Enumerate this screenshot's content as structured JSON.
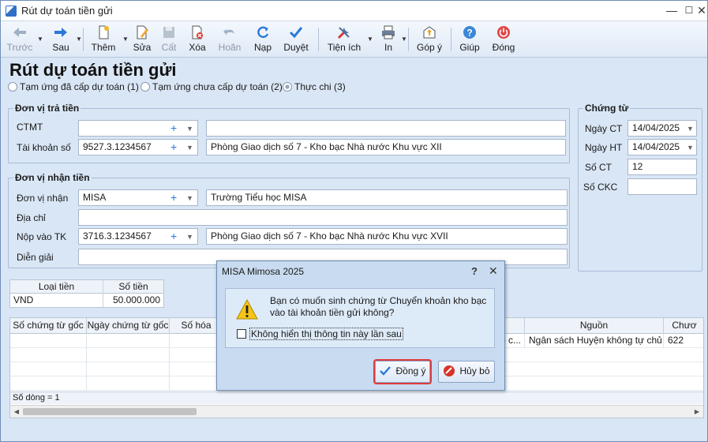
{
  "window": {
    "title": "Rút dự toán tiền gửi",
    "min": "—",
    "max": "☐",
    "close": "✕"
  },
  "toolbar": {
    "back": "Trước",
    "next": "Sau",
    "add": "Thêm",
    "edit": "Sửa",
    "save": "Cất",
    "delete": "Xóa",
    "undo": "Hoãn",
    "reload": "Nạp",
    "approve": "Duyệt",
    "utilities": "Tiện ích",
    "print": "In",
    "feedback": "Góp ý",
    "help": "Giúp",
    "close": "Đóng"
  },
  "page": {
    "title": "Rút dự toán tiền gửi",
    "radios": [
      "Tạm ứng đã cấp dự toán (1)",
      "Tạm ứng chưa cấp dự toán (2)",
      "Thực chi (3)"
    ]
  },
  "payer": {
    "legend": "Đơn vị trả tiền",
    "ctmt_label": "CTMT",
    "ctmt_value": "",
    "ctmt_desc": "",
    "account_label": "Tài khoản số",
    "account_value": "9527.3.1234567",
    "account_desc": "Phòng Giao dịch số 7 - Kho bạc Nhà nước Khu vực XII"
  },
  "receiver": {
    "legend": "Đơn vị nhận tiền",
    "unit_label": "Đơn vị nhận",
    "unit_value": "MISA",
    "unit_desc": "Trường Tiểu học MISA",
    "address_label": "Địa chỉ",
    "address_value": "",
    "deposit_label": "Nộp vào TK",
    "deposit_value": "3716.3.1234567",
    "deposit_desc": "Phòng Giao dịch số 7 - Kho bạc Nhà nước Khu vực XVII",
    "note_label": "Diễn giải",
    "note_value": ""
  },
  "voucher": {
    "legend": "Chứng từ",
    "date_ct_label": "Ngày CT",
    "date_ct": "14/04/2025",
    "date_ht_label": "Ngày HT",
    "date_ht": "14/04/2025",
    "no_ct_label": "Số CT",
    "no_ct": "12",
    "no_ckc_label": "Số CKC",
    "no_ckc": ""
  },
  "currency_table": {
    "headers": [
      "Loại tiền",
      "Số tiền"
    ],
    "row": [
      "VND",
      "50.000.000"
    ]
  },
  "grid": {
    "headers": [
      "Số chứng từ gốc",
      "Ngày chứng từ gốc",
      "Số hóa",
      "Nguồn",
      "Chươ"
    ],
    "row1": {
      "partial": "o c...",
      "source": "Ngân sách Huyện không tự chủ",
      "chapter": "622"
    },
    "footer": "Số dòng = 1"
  },
  "dialog": {
    "title": "MISA Mimosa 2025",
    "help": "?",
    "close": "✕",
    "message": "Bạn có muốn sinh chứng từ Chuyển khoản kho bạc vào tài khoản tiền gửi không?",
    "checkbox": "Không hiển thị thông tin này lần sau",
    "ok": "Đồng ý",
    "cancel": "Hủy bỏ"
  }
}
